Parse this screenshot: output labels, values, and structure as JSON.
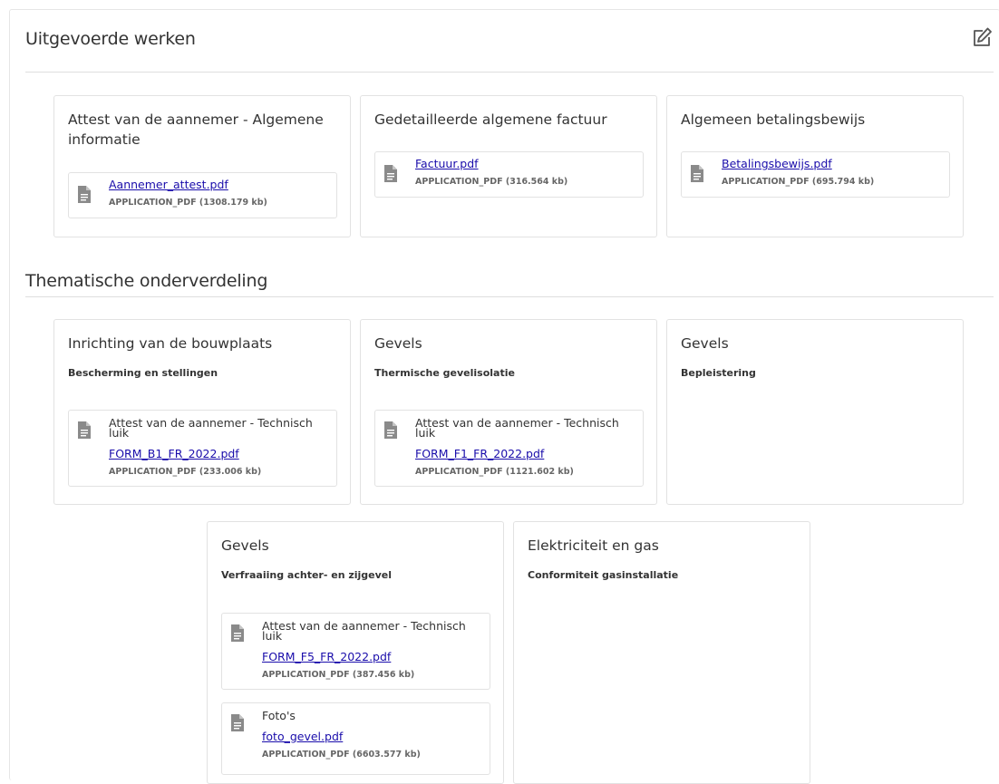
{
  "section1": {
    "title": "Uitgevoerde werken"
  },
  "section2": {
    "title": "Thematische onderverdeling"
  },
  "cards_top": [
    {
      "title": "Attest van de aannemer - Algemene informatie",
      "file": {
        "link": "Aannemer_attest.pdf",
        "meta": "APPLICATION_PDF (1308.179 kb)"
      }
    },
    {
      "title": "Gedetailleerde algemene factuur",
      "file": {
        "link": "Factuur.pdf",
        "meta": "APPLICATION_PDF (316.564 kb)"
      }
    },
    {
      "title": "Algemeen betalingsbewijs",
      "file": {
        "link": "Betalingsbewijs.pdf",
        "meta": "APPLICATION_PDF (695.794 kb)"
      }
    }
  ],
  "cards_theme": [
    {
      "title": "Inrichting van de bouwplaats",
      "subtitle": "Bescherming en stellingen",
      "files": [
        {
          "desc": "Attest van de aannemer - Technisch luik",
          "link": "FORM_B1_FR_2022.pdf",
          "meta": "APPLICATION_PDF (233.006 kb)"
        }
      ]
    },
    {
      "title": "Gevels",
      "subtitle": "Thermische gevelisolatie",
      "files": [
        {
          "desc": "Attest van de aannemer - Technisch luik",
          "link": "FORM_F1_FR_2022.pdf",
          "meta": "APPLICATION_PDF (1121.602 kb)"
        }
      ]
    },
    {
      "title": "Gevels",
      "subtitle": "Bepleistering",
      "files": []
    },
    {
      "title": "Gevels",
      "subtitle": "Verfraaiing achter- en zijgevel",
      "files": [
        {
          "desc": "Attest van de aannemer - Technisch luik",
          "link": "FORM_F5_FR_2022.pdf",
          "meta": "APPLICATION_PDF (387.456 kb)"
        },
        {
          "desc": "Foto's",
          "link": "foto_gevel.pdf",
          "meta": "APPLICATION_PDF (6603.577 kb)"
        }
      ]
    },
    {
      "title": "Elektriciteit en gas",
      "subtitle": "Conformiteit gasinstallatie",
      "files": []
    }
  ]
}
